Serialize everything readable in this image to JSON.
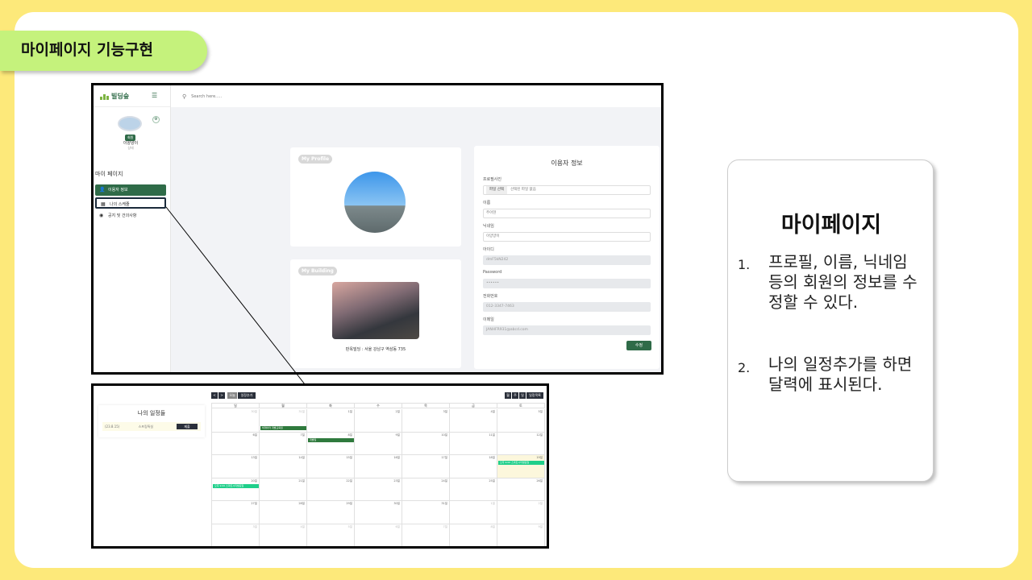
{
  "banner": "마이페이지 기능구현",
  "app": {
    "logo": "빌딩숲",
    "menu_icon": "hamburger-icon",
    "search_placeholder": "Search here.....",
    "user": {
      "badge": "회원",
      "name": "이양양이",
      "status": "상태"
    },
    "section_title": "마이 페이지",
    "menu": [
      {
        "label": "이용자 정보",
        "icon": "user-icon",
        "active": true
      },
      {
        "label": "나의 스케줄",
        "icon": "calendar-icon",
        "active": false
      },
      {
        "label": "공지 및 건의사항",
        "icon": "notice-icon",
        "active": false
      }
    ],
    "profile_card": {
      "title": "My Profile"
    },
    "building_card": {
      "title": "My Building",
      "caption": "판옥빌딩 : 서울 강남구 역삼동 735"
    },
    "form": {
      "title": "이용자 정보",
      "fields": [
        {
          "label": "프로필사진",
          "button": "파일 선택",
          "value": "선택된 파일 없음"
        },
        {
          "label": "이름",
          "value": "주아현"
        },
        {
          "label": "닉네임",
          "value": "이양양이"
        },
        {
          "label": "아이디",
          "value": "dmF5kN242"
        },
        {
          "label": "Password",
          "value": "••••••"
        },
        {
          "label": "전화번호",
          "value": "012-3347-7463"
        },
        {
          "label": "이메일",
          "value": "JANHFR931@abcd.com"
        }
      ],
      "submit": "수정"
    }
  },
  "calendar": {
    "schedule_title": "나의 일정들",
    "schedule_item": {
      "date": "(23.8.15)",
      "text": "스프링특실",
      "button": "제출"
    },
    "nav": {
      "prev": "<",
      "next": ">",
      "today": "오늘",
      "add": "일정추가"
    },
    "views": [
      "월",
      "주",
      "일",
      "일정목록"
    ],
    "weekdays": [
      "일",
      "월",
      "화",
      "수",
      "목",
      "금",
      "토"
    ],
    "weeks": [
      [
        "30일",
        "31일",
        "1일",
        "2일",
        "3일",
        "4일",
        "5일"
      ],
      [
        "6일",
        "7일",
        "8일",
        "9일",
        "10일",
        "11일",
        "12일"
      ],
      [
        "13일",
        "14일",
        "15일",
        "16일",
        "17일",
        "18일",
        "19일"
      ],
      [
        "20일",
        "21일",
        "22일",
        "23일",
        "24일",
        "25일",
        "26일"
      ],
      [
        "27일",
        "28일",
        "29일",
        "30일",
        "31일",
        "1일",
        "2일"
      ],
      [
        "3일",
        "4일",
        "5일",
        "6일",
        "7일",
        "8일",
        "9일"
      ]
    ],
    "events": [
      "빅데이터 개발교육일",
      "개발일",
      "오후 9:00 스마트시티발표일",
      "오후 9:00 스마트시티발표일"
    ]
  },
  "note": {
    "title": "마이페이지",
    "items": [
      {
        "num": "1.",
        "text": "프로필, 이름, 닉네임 등의 회원의 정보를 수정할 수 있다."
      },
      {
        "num": "2.",
        "text": "나의 일정추가를 하면 달력에 표시된다."
      }
    ]
  }
}
